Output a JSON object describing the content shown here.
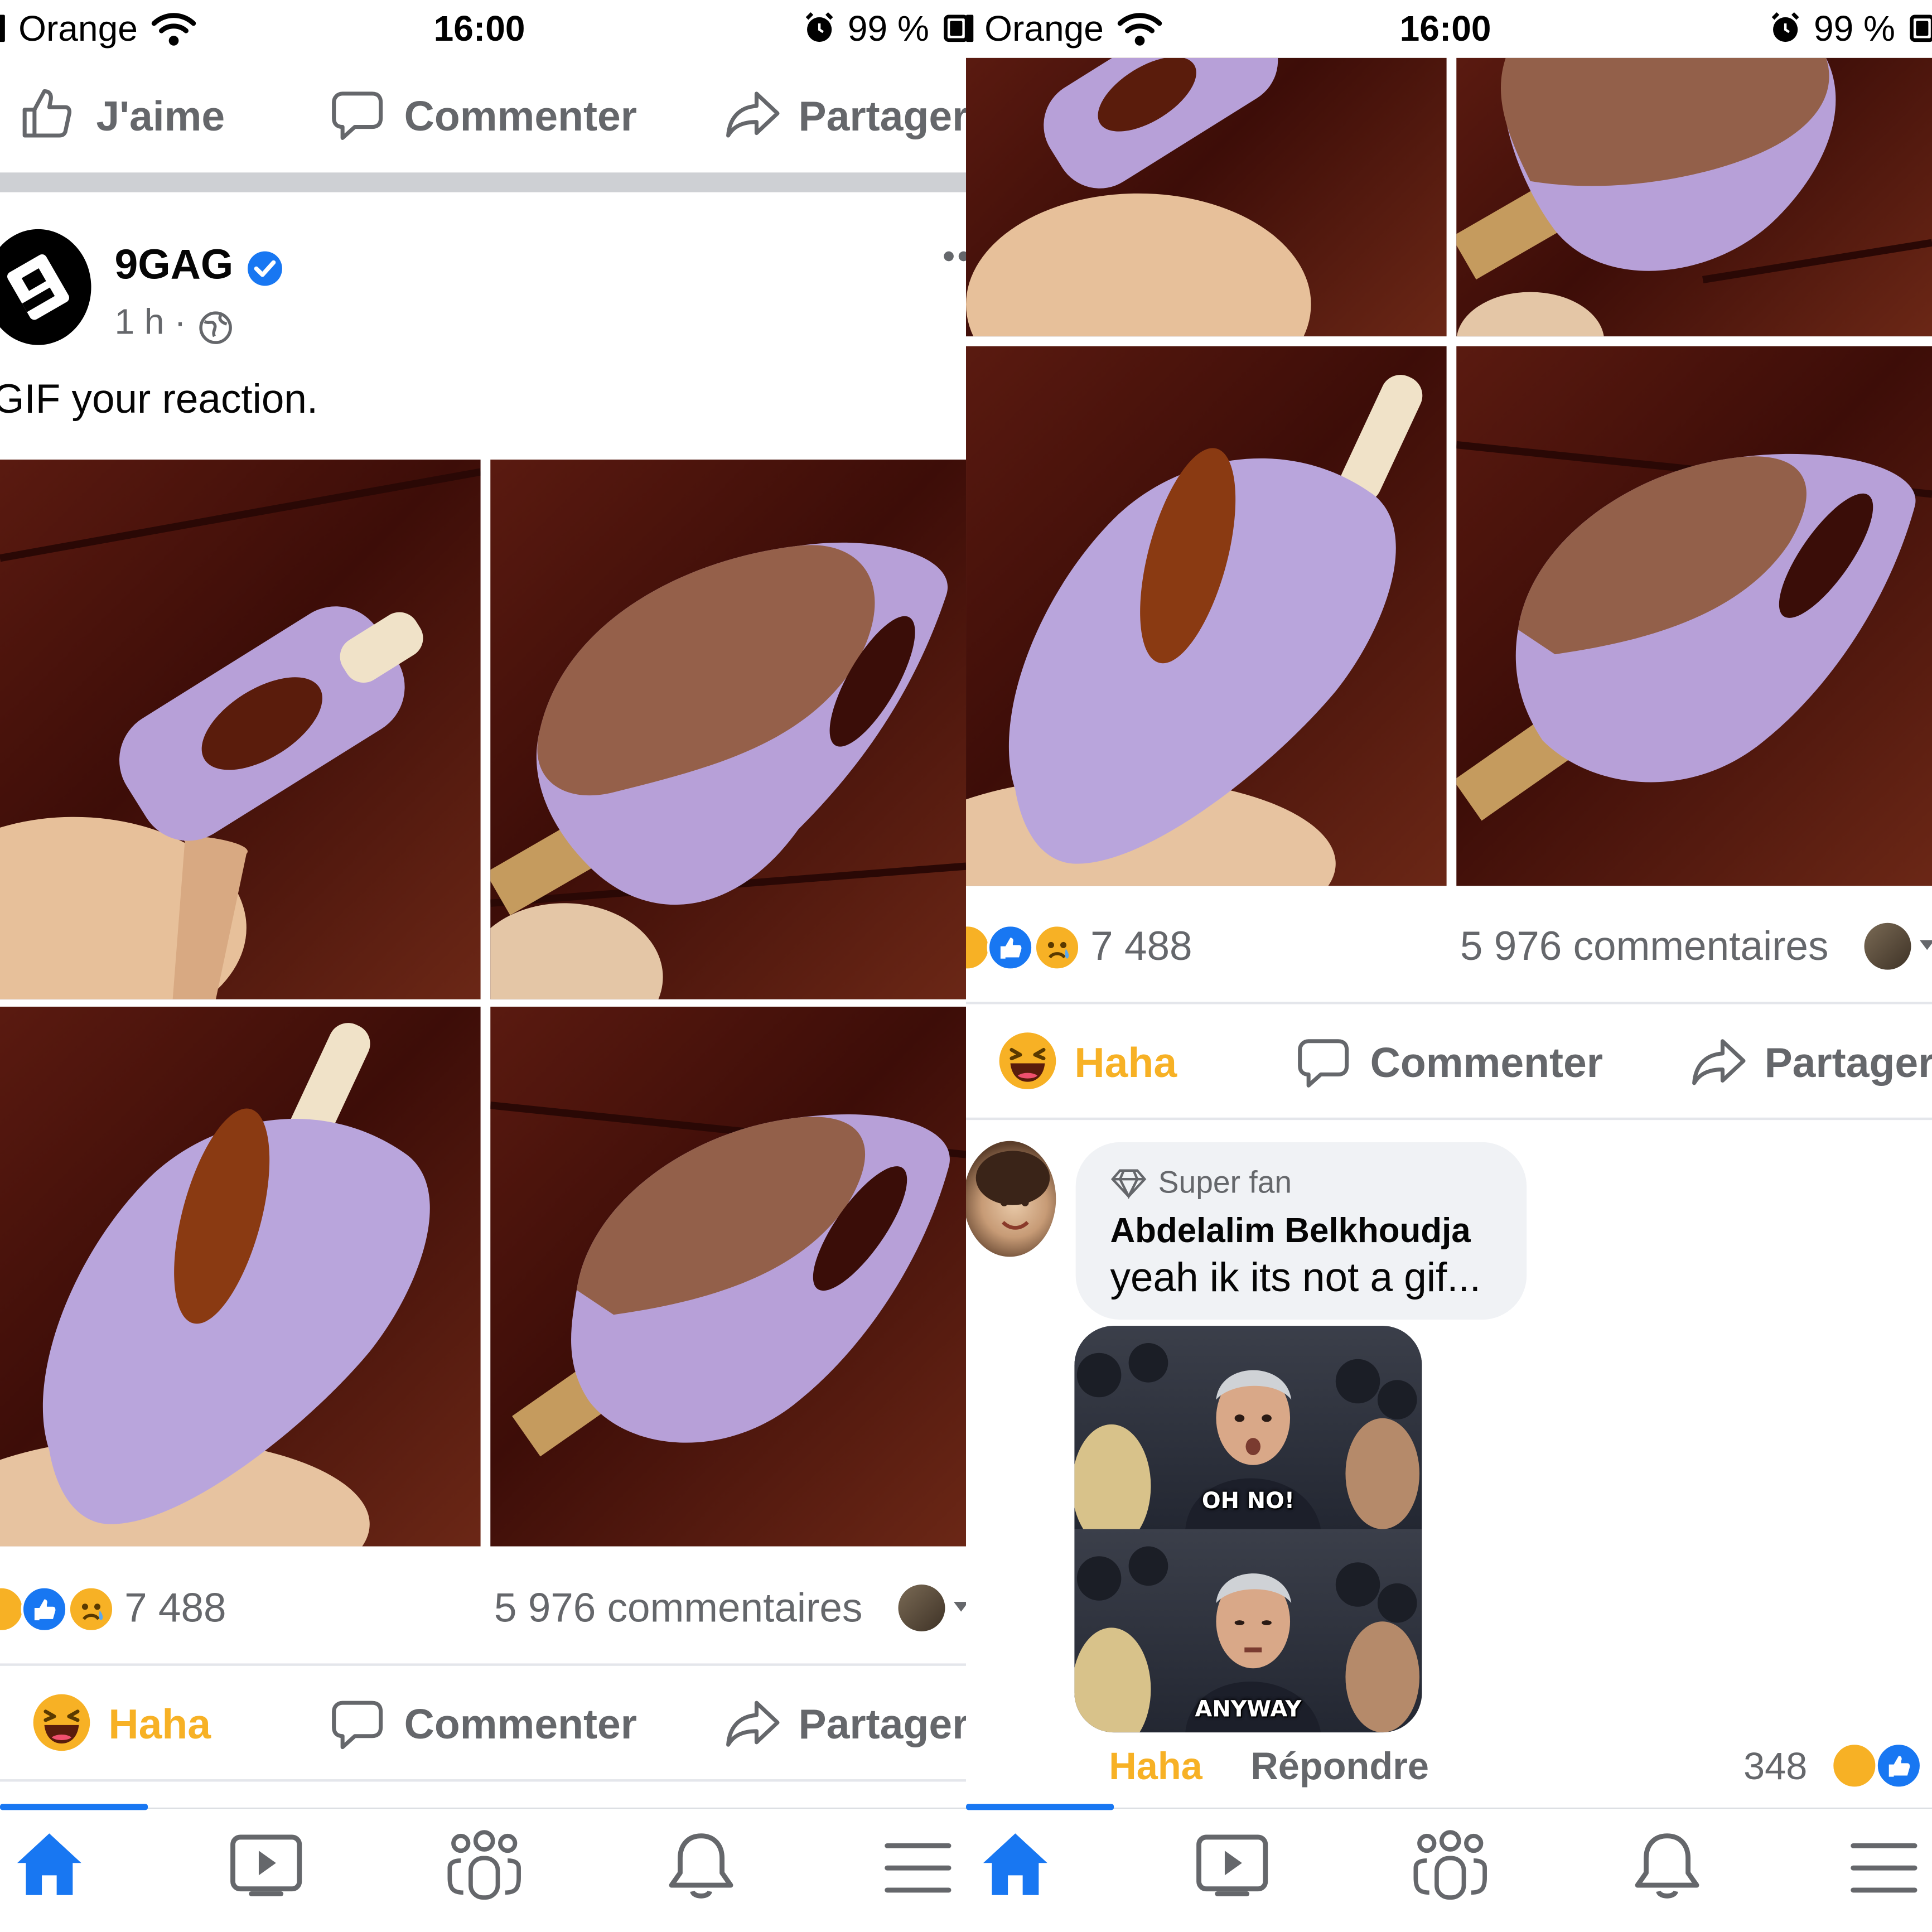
{
  "status_bar": {
    "carrier": "Orange",
    "time": "16:00",
    "battery": "99 %"
  },
  "post": {
    "actions": {
      "like": "J'aime",
      "comment": "Commenter",
      "share": "Partager",
      "haha": "Haha"
    },
    "author": "9GAG",
    "time": "1 h ·",
    "caption": "GIF your reaction.",
    "reaction_count": "7 488",
    "comments_count": "5 976 commentaires"
  },
  "comment": {
    "badge": "Super fan",
    "author": "Abdelalim Belkhoudja",
    "text": "yeah ik its not a gif...",
    "gif_top": "OH NO!",
    "gif_bottom": "ANYWAY",
    "haha": "Haha",
    "reply": "Répondre",
    "reaction_count": "348"
  },
  "colors": {
    "facebook_blue": "#1877f2",
    "haha_yellow": "#f7b125",
    "secondary_text": "#65676b"
  },
  "icons": [
    "wifi-icon",
    "alarm-icon",
    "battery-icon",
    "like-icon",
    "comment-icon",
    "share-icon",
    "verified-icon",
    "globe-icon",
    "more-icon",
    "home-icon",
    "watch-icon",
    "groups-icon",
    "notifications-icon",
    "menu-icon",
    "diamond-icon"
  ]
}
